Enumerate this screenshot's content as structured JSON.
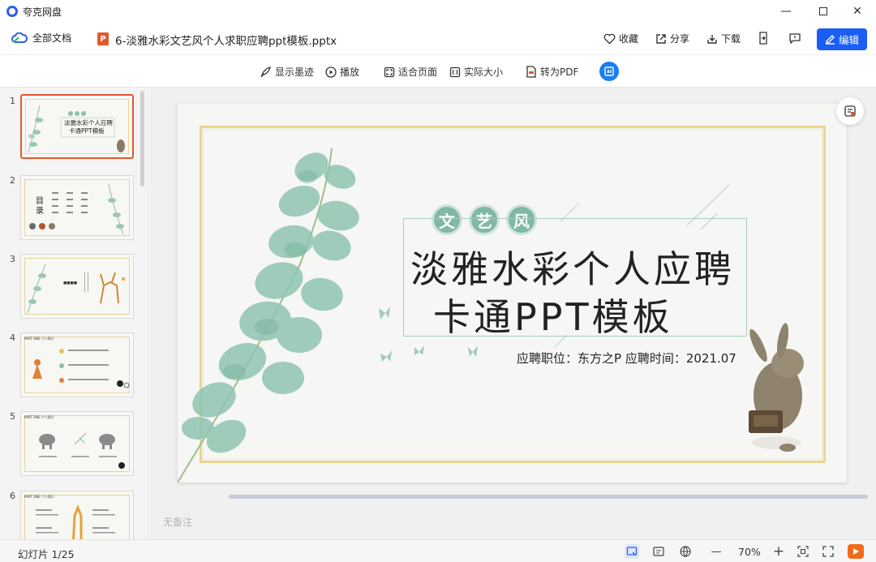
{
  "app": {
    "title": "夸克网盘"
  },
  "header": {
    "all_docs": "全部文档",
    "file_type": "P",
    "filename": "6-淡雅水彩文艺风个人求职应聘ppt模板.pptx",
    "favorite": "收藏",
    "share": "分享",
    "download": "下载",
    "edit": "编辑"
  },
  "toolbar": {
    "show_ink": "显示墨迹",
    "play": "播放",
    "fit_page": "适合页面",
    "actual_size": "实际大小",
    "to_pdf": "转为PDF"
  },
  "thumbnails": [
    {
      "number": "1"
    },
    {
      "number": "2"
    },
    {
      "number": "3"
    },
    {
      "number": "4"
    },
    {
      "number": "5"
    },
    {
      "number": "6"
    }
  ],
  "slide": {
    "tag1": "文",
    "tag2": "艺",
    "tag3": "风",
    "title_line1": "淡雅水彩个人应聘",
    "title_line2": "卡通PPT模板",
    "subtitle": "应聘职位：东方之P   应聘时间：2021.07"
  },
  "notes_placeholder": "无备注",
  "status": {
    "slide_count": "幻灯片 1/25",
    "zoom": "70%",
    "zoom_out": "—",
    "zoom_in": "+"
  },
  "colors": {
    "accent": "#1a5ef5",
    "ppt_orange": "#e4572e",
    "leaf": "#7fb8a4",
    "gold": "#e8d78d"
  }
}
